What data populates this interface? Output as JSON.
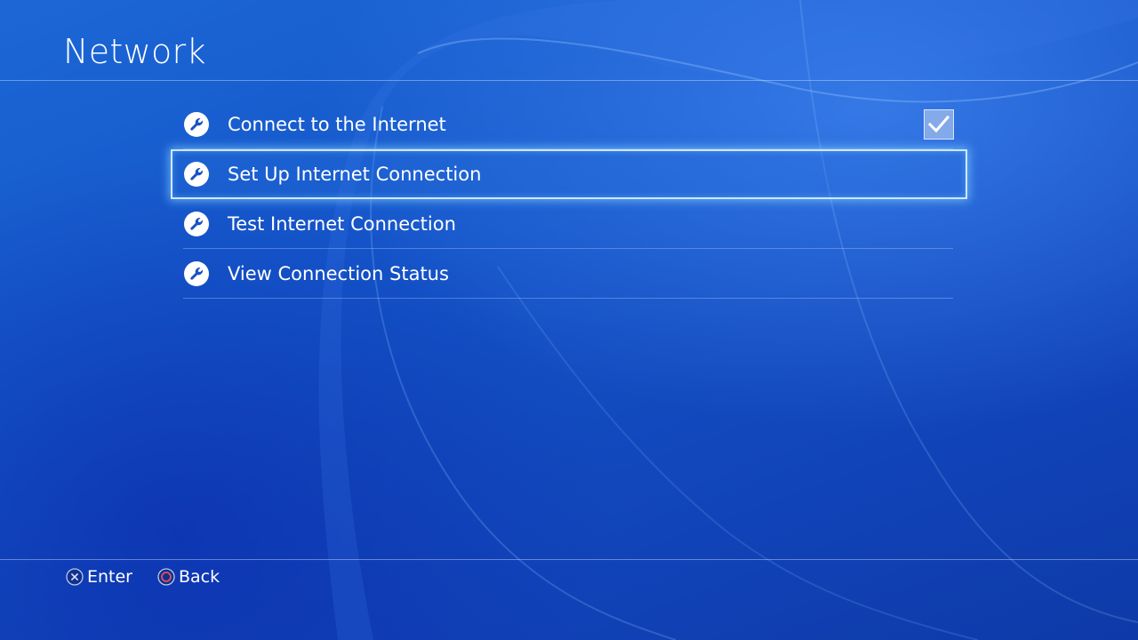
{
  "header": {
    "title": "Network"
  },
  "menu": {
    "items": [
      {
        "label": "Connect to the Internet",
        "icon": "wrench-icon",
        "checked": true
      },
      {
        "label": "Set Up Internet Connection",
        "icon": "wrench-icon",
        "selected": true
      },
      {
        "label": "Test Internet Connection",
        "icon": "wrench-icon"
      },
      {
        "label": "View Connection Status",
        "icon": "wrench-icon"
      }
    ]
  },
  "footer": {
    "enter_label": "Enter",
    "enter_icon": "cross-button-icon",
    "back_label": "Back",
    "back_icon": "circle-button-icon"
  },
  "colors": {
    "background": "#1650c9",
    "selection_glow": "#cfe6ff",
    "circle_button": "#e0525c"
  }
}
